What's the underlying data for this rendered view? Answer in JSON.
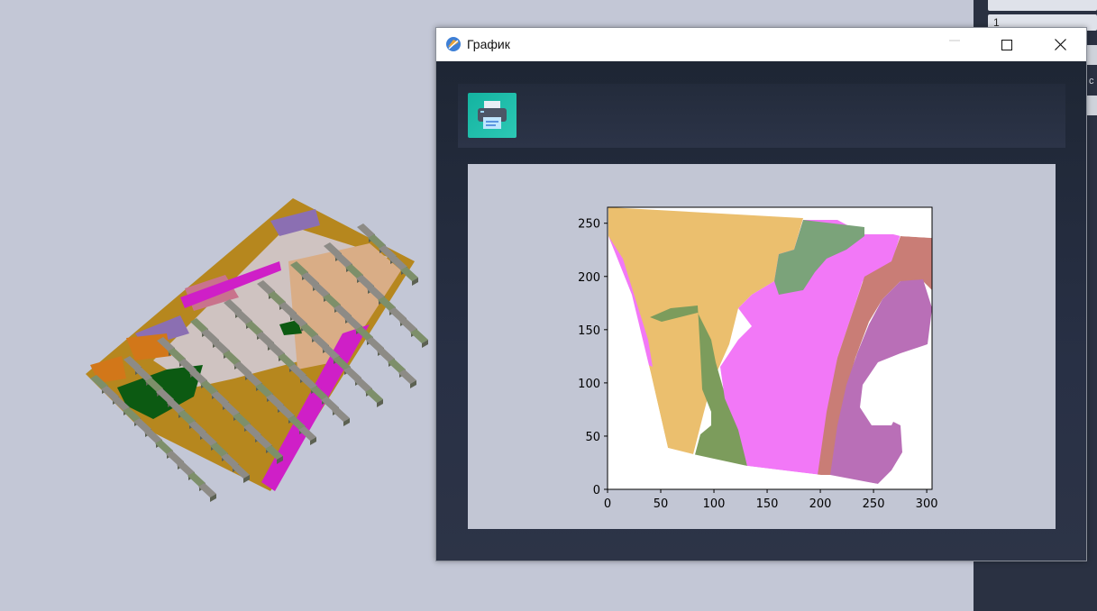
{
  "window": {
    "title": "График",
    "app_icon": "app-logo-icon",
    "controls": {
      "minimize": "minimize-icon",
      "maximize": "maximize-icon",
      "close": "close-icon"
    }
  },
  "toolbar": {
    "print_icon": "printer-icon"
  },
  "side_panel": {
    "field_1_value": "1",
    "partial_label": "с"
  },
  "colors": {
    "sand": "#ebbf6e",
    "green": "#7c9c5c",
    "teal_green": "#7ba37a",
    "magenta": "#f278f7",
    "brown_red": "#c97d76",
    "purple": "#b96fb7",
    "window_bg": "#1f2736",
    "print_button": "#1dbfa9",
    "plot_bg": "#c2c6d4"
  },
  "chart_data": {
    "type": "heatmap",
    "description_source": "2D cross-section map of categorical regions",
    "title": "",
    "xlabel": "",
    "ylabel": "",
    "xlim": [
      0,
      305
    ],
    "ylim": [
      0,
      265
    ],
    "xticks": [
      0,
      50,
      100,
      150,
      200,
      250,
      300
    ],
    "yticks": [
      0,
      50,
      100,
      150,
      200,
      250
    ],
    "grid": false,
    "legend": "none"
  }
}
